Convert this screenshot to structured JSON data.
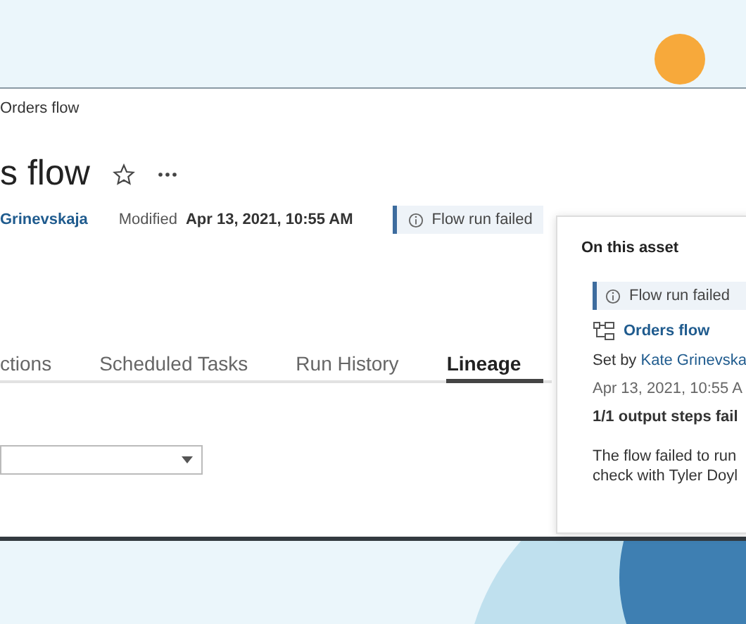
{
  "breadcrumb": "Orders flow",
  "title": "s flow",
  "owner": "Grinevskaja",
  "modified": {
    "label": "Modified",
    "value": "Apr 13, 2021, 10:55 AM"
  },
  "status_badge": {
    "text": "Flow run failed"
  },
  "tabs": [
    {
      "label": "ctions",
      "selected": false
    },
    {
      "label": "Scheduled Tasks",
      "selected": false
    },
    {
      "label": "Run History",
      "selected": false
    },
    {
      "label": "Lineage",
      "selected": true
    }
  ],
  "popover": {
    "heading": "On this asset",
    "alert": "Flow run failed",
    "flow_link": "Orders flow",
    "set_by_label": "Set by",
    "set_by_name": "Kate Grinevska",
    "date": "Apr 13, 2021, 10:55 A",
    "summary": "1/1 output steps fail",
    "message_lines": [
      "The flow failed to run",
      "check with Tyler Doyl"
    ]
  }
}
